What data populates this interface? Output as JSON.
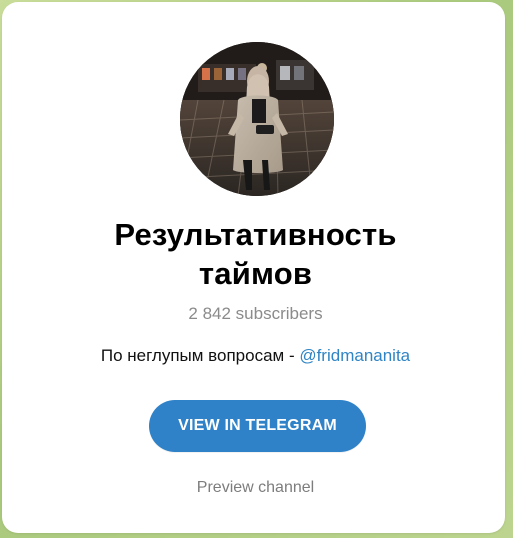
{
  "channel": {
    "title_line1": "Результативность",
    "title_line2": "таймов",
    "subscribers": "2 842 subscribers",
    "description_text": "По неглупым вопросам - ",
    "description_link": "@fridmananita"
  },
  "actions": {
    "view_button": "VIEW IN TELEGRAM",
    "preview_link": "Preview channel"
  },
  "colors": {
    "button": "#2f82c8",
    "link": "#2f84c5",
    "muted": "#8b8b8b"
  },
  "icons": {
    "avatar": "channel-avatar-photo"
  }
}
